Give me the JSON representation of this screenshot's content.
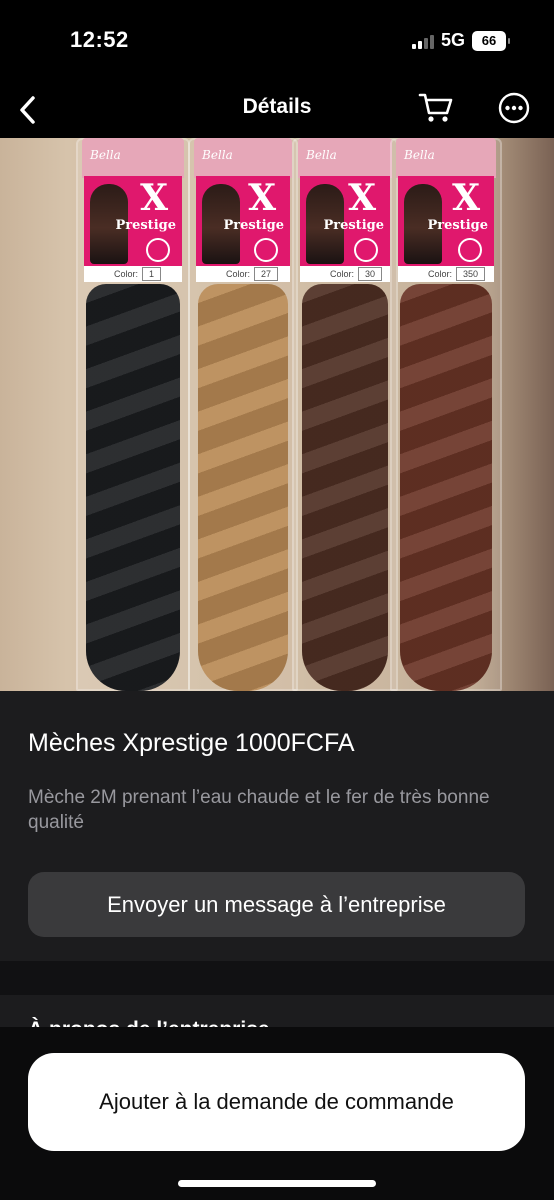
{
  "status_bar": {
    "time": "12:52",
    "network": "5G",
    "battery": "66"
  },
  "nav": {
    "title": "Détails",
    "back_icon": "chevron-left-icon",
    "cart_icon": "cart-icon",
    "more_icon": "more-icon"
  },
  "product_image": {
    "packs": [
      {
        "color_label": "Color:",
        "color_code": "1",
        "hair_color": "#1b1d20",
        "header_text": "Bella",
        "logo_letter": "X",
        "logo_word": "Prestige"
      },
      {
        "color_label": "Color:",
        "color_code": "27",
        "hair_color": "#b98a55",
        "header_text": "Bella",
        "logo_letter": "X",
        "logo_word": "Prestige"
      },
      {
        "color_label": "Color:",
        "color_code": "30",
        "hair_color": "#4e2f23",
        "header_text": "Bella",
        "logo_letter": "X",
        "logo_word": "Prestige"
      },
      {
        "color_label": "Color:",
        "color_code": "350",
        "hair_color": "#6a3426",
        "header_text": "Bella",
        "logo_letter": "X",
        "logo_word": "Prestige"
      }
    ]
  },
  "product": {
    "title": "Mèches Xprestige 1000FCFA",
    "description": "Mèche 2M prenant l’eau chaude et le fer de très bonne qualité",
    "message_button": "Envoyer un message à l’entreprise"
  },
  "about": {
    "label": "À propos de l’entreprise"
  },
  "bottom": {
    "order_button": "Ajouter à la demande de commande"
  }
}
